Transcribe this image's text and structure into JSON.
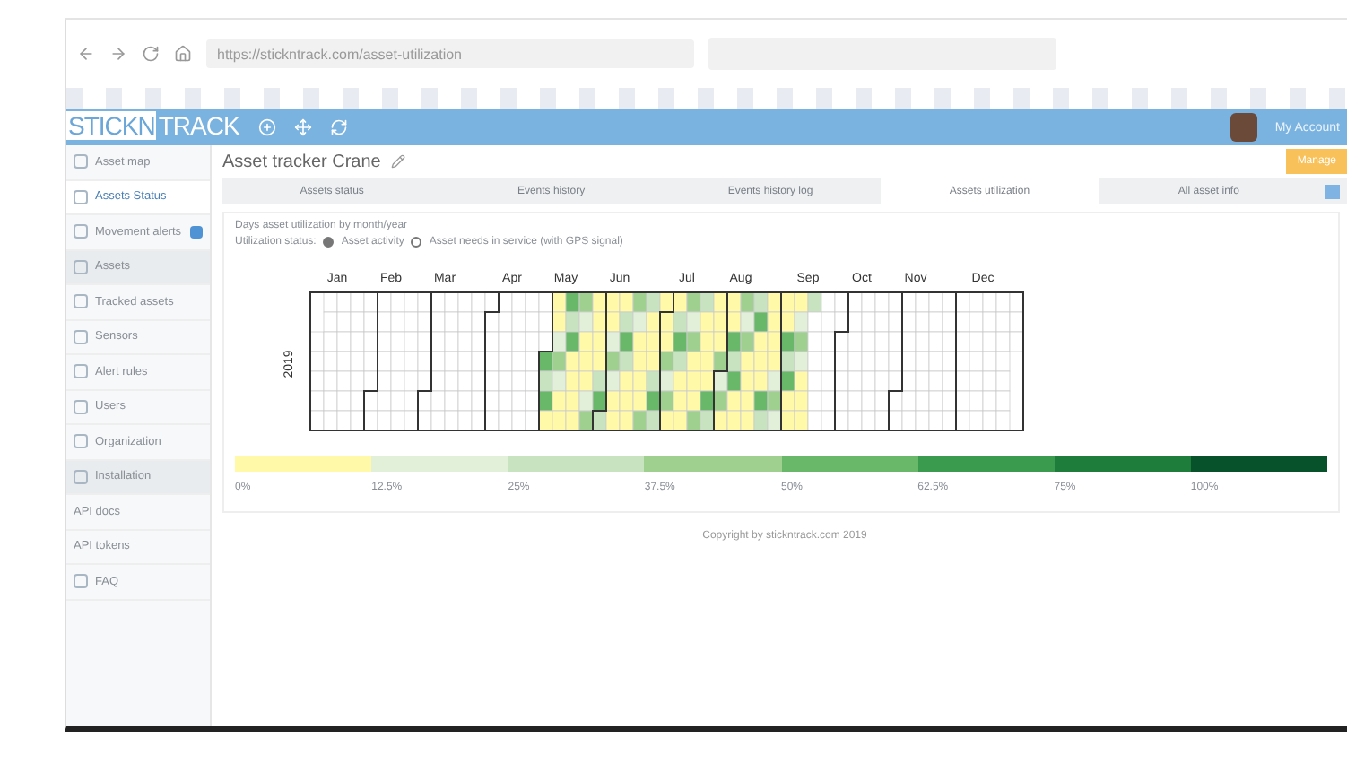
{
  "browser": {
    "url": "https://stickntrack.com/asset-utilization"
  },
  "app": {
    "logo_left": "STICKN",
    "logo_right": "TRACK",
    "user": "My Account"
  },
  "sidebar": {
    "items": [
      {
        "label": "Asset map",
        "kind": "link",
        "selected": false
      },
      {
        "label": "Assets Status",
        "kind": "link",
        "selected": true
      },
      {
        "label": "Movement alerts",
        "kind": "badge",
        "selected": false
      },
      {
        "label": "Assets",
        "kind": "group",
        "selected": false
      },
      {
        "label": "Tracked assets",
        "kind": "link",
        "selected": false
      },
      {
        "label": "Sensors",
        "kind": "link",
        "selected": false
      },
      {
        "label": "Alert rules",
        "kind": "link",
        "selected": false
      },
      {
        "label": "Users",
        "kind": "link",
        "selected": false
      },
      {
        "label": "Organization",
        "kind": "link",
        "selected": false
      },
      {
        "label": "Installation",
        "kind": "group",
        "selected": false
      },
      {
        "label": "API docs",
        "kind": "plain",
        "selected": false
      },
      {
        "label": "API tokens",
        "kind": "plain",
        "selected": false
      },
      {
        "label": "FAQ",
        "kind": "link",
        "selected": false
      }
    ]
  },
  "page": {
    "title": "Asset tracker Crane",
    "action": "Manage"
  },
  "tabs": [
    {
      "label": "Assets status",
      "selected": false
    },
    {
      "label": "Events history",
      "selected": false
    },
    {
      "label": "Events history log",
      "selected": false
    },
    {
      "label": "Assets utilization",
      "selected": true
    },
    {
      "label": "All asset info",
      "selected": false
    }
  ],
  "panel": {
    "heading": "Days asset utilization by month/year",
    "legend_title": "Utilization status:",
    "legend": [
      {
        "label": "Asset activity",
        "kind": "filled"
      },
      {
        "label": "Asset needs in service (with GPS signal)",
        "kind": "hollow"
      }
    ],
    "year": "2019",
    "months": [
      "Jan",
      "Feb",
      "Mar",
      "Apr",
      "May",
      "Jun",
      "Jul",
      "Aug",
      "Sep",
      "Oct",
      "Nov",
      "Dec"
    ],
    "scale": [
      {
        "label": "0%",
        "color": "#fff9a8"
      },
      {
        "label": "12.5%",
        "color": "#e2efd9"
      },
      {
        "label": "25%",
        "color": "#c7e3bf"
      },
      {
        "label": "37.5%",
        "color": "#9fd08f"
      },
      {
        "label": "50%",
        "color": "#69b86a"
      },
      {
        "label": "62.5%",
        "color": "#3a9a4e"
      },
      {
        "label": "75%",
        "color": "#1f7d3b"
      },
      {
        "label": "100%",
        "color": "#07522a"
      }
    ]
  },
  "footer": "Copyright by stickntrack.com 2019"
}
